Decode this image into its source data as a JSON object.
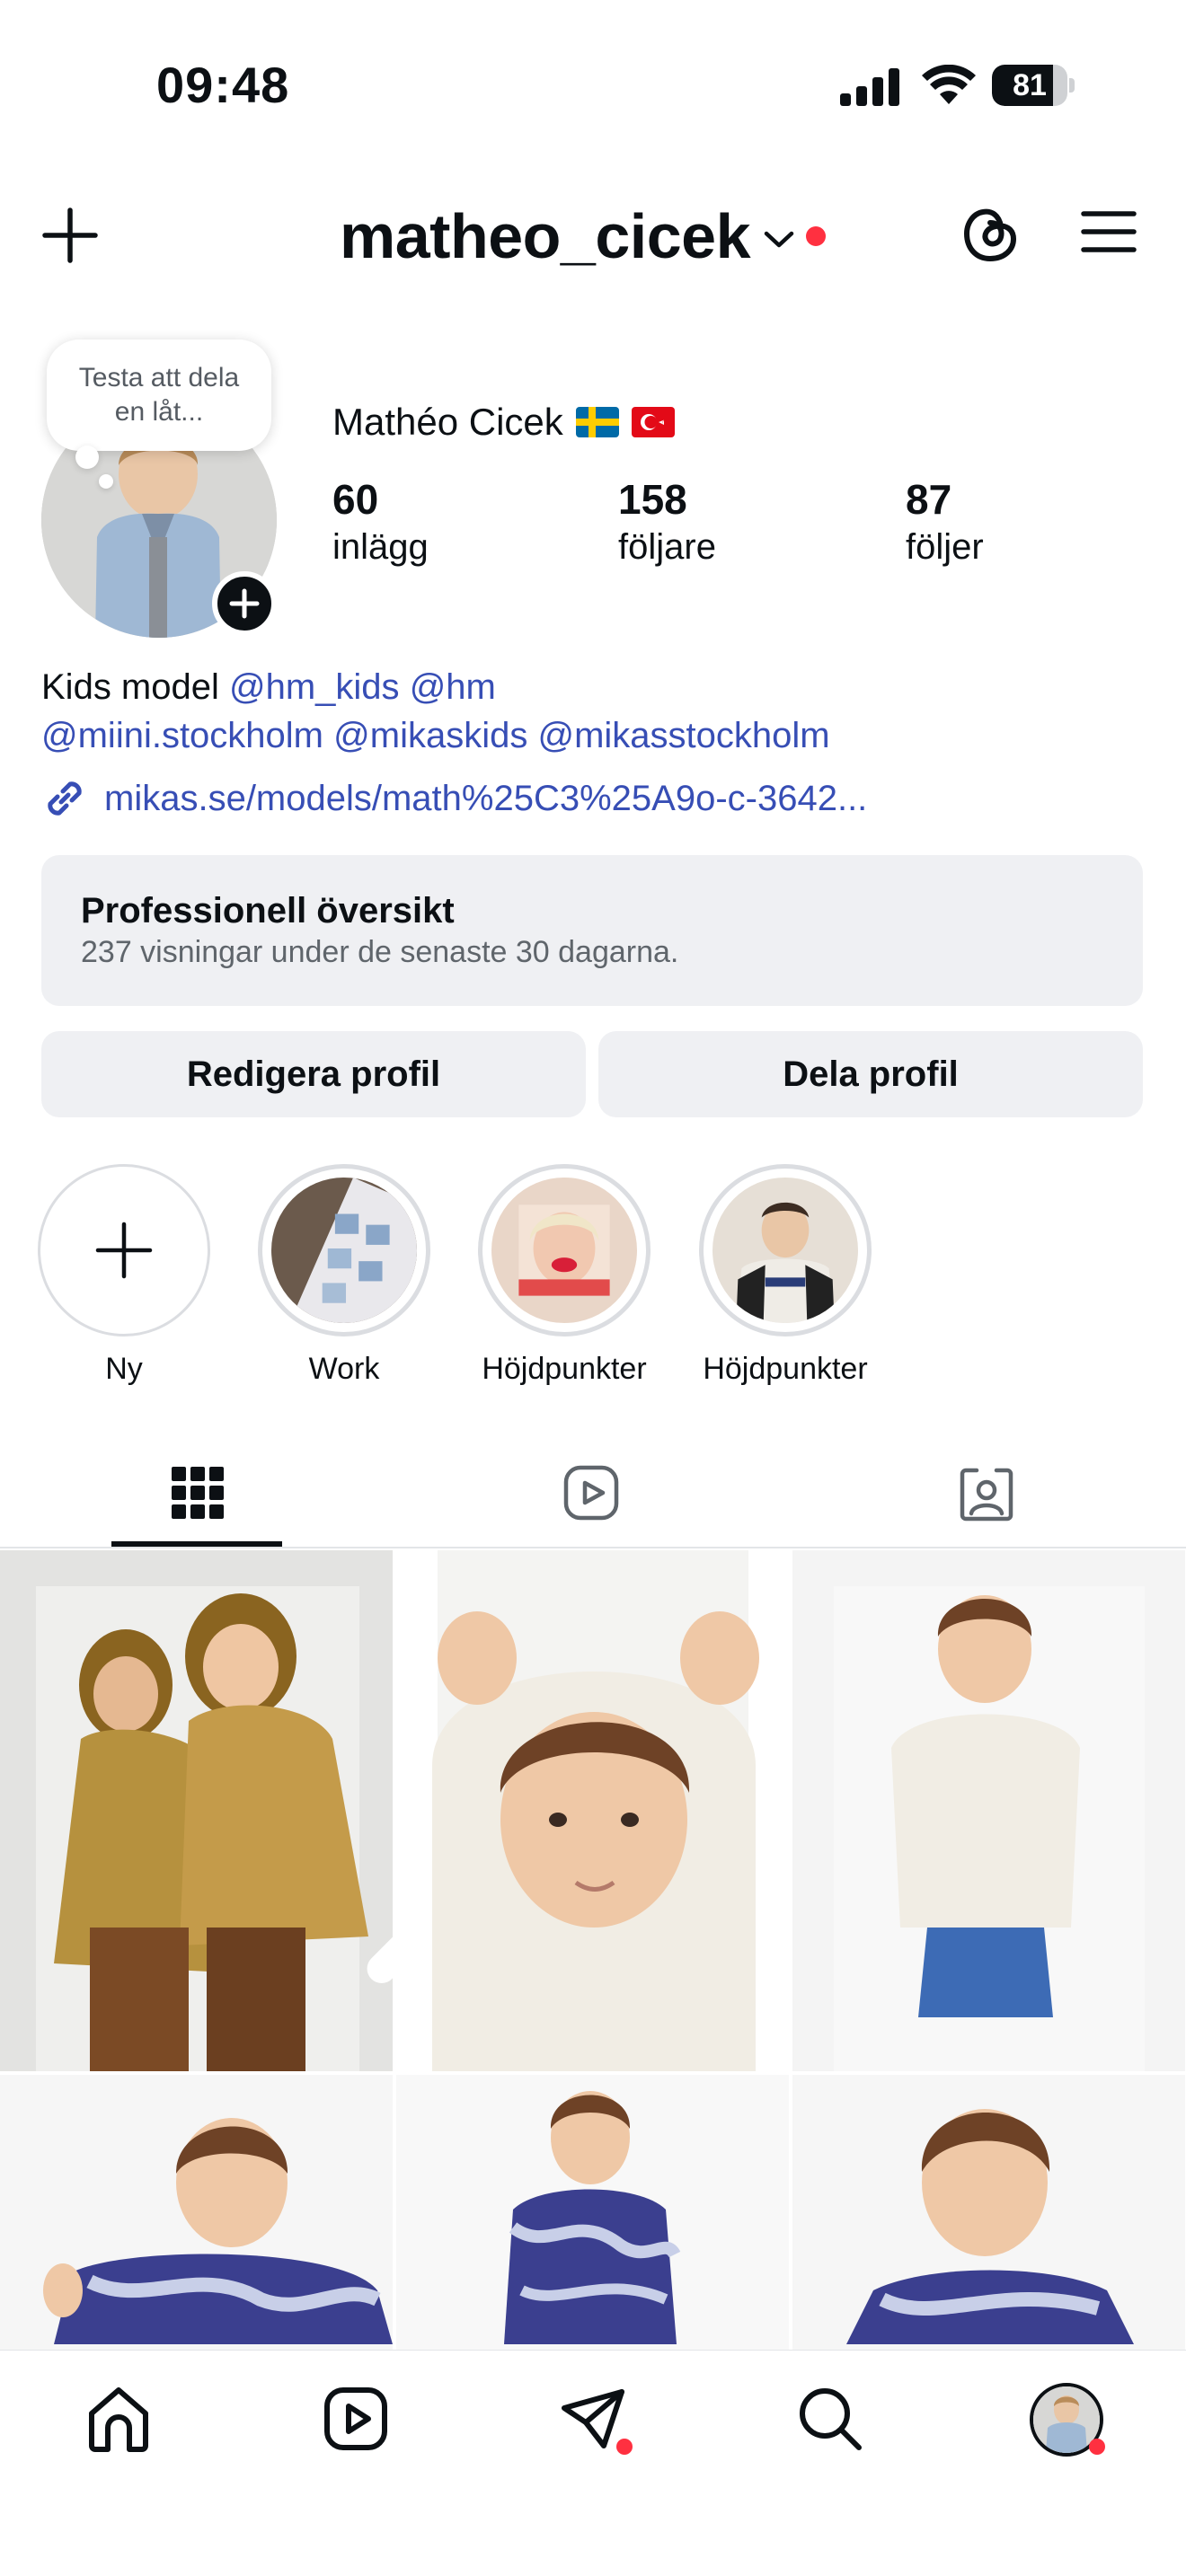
{
  "status_bar": {
    "time": "09:48",
    "battery": "81",
    "battery_level": 0.81
  },
  "header": {
    "username": "matheo_cicek"
  },
  "note": {
    "text": "Testa att dela en låt..."
  },
  "profile": {
    "name": "Mathéo Cicek",
    "stats": [
      {
        "value": "60",
        "label": "inlägg"
      },
      {
        "value": "158",
        "label": "följare"
      },
      {
        "value": "87",
        "label": "följer"
      }
    ]
  },
  "bio": {
    "text": "Kids model",
    "mentions_line1": [
      "@hm_kids",
      "@hm"
    ],
    "mentions_line2": [
      "@miini.stockholm",
      "@mikaskids",
      "@mikasstockholm"
    ],
    "link": "mikas.se/models/math%25C3%25A9o-c-3642..."
  },
  "dashboard": {
    "title": "Professionell översikt",
    "subtitle": "237 visningar under de senaste 30 dagarna."
  },
  "buttons": {
    "edit": "Redigera profil",
    "share": "Dela profil"
  },
  "highlights": [
    {
      "label": "Ny"
    },
    {
      "label": "Work"
    },
    {
      "label": "Höjdpunkter"
    },
    {
      "label": "Höjdpunkter"
    }
  ],
  "tabs": [
    {
      "icon": "grid-icon",
      "active": true
    },
    {
      "icon": "reels-icon",
      "active": false
    },
    {
      "icon": "tagged-icon",
      "active": false
    }
  ],
  "bottom_nav": [
    {
      "icon": "home-icon"
    },
    {
      "icon": "reels-icon"
    },
    {
      "icon": "direct-icon"
    },
    {
      "icon": "search-icon"
    },
    {
      "icon": "profile-avatar"
    }
  ],
  "colors": {
    "accent_link": "#374eb5",
    "notification": "#ff3040",
    "surface": "#eff0f3"
  }
}
